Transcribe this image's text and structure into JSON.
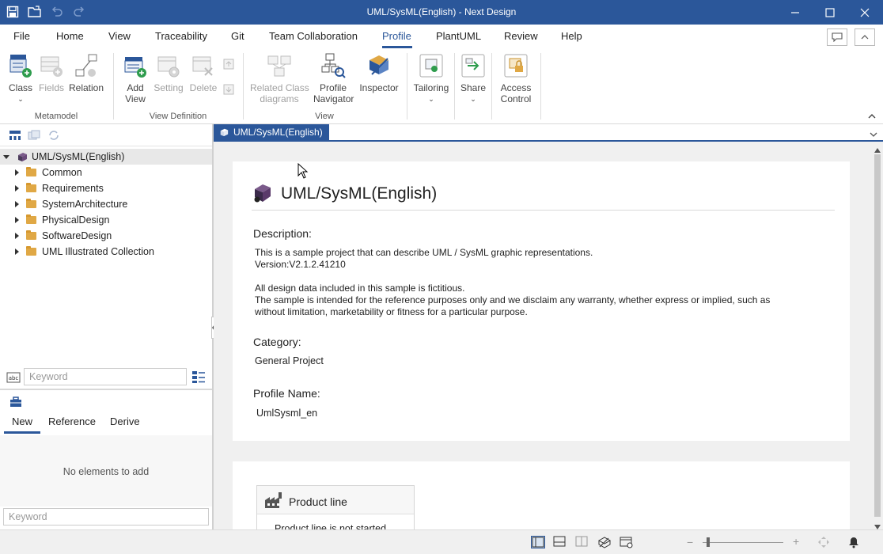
{
  "window": {
    "title": "UML/SysML(English) - Next Design"
  },
  "menu": {
    "items": [
      "File",
      "Home",
      "View",
      "Traceability",
      "Git",
      "Team Collaboration",
      "Profile",
      "PlantUML",
      "Review",
      "Help"
    ],
    "active": "Profile"
  },
  "ribbon": {
    "groups": {
      "metamodel": "Metamodel",
      "view_definition": "View Definition",
      "view": "View"
    },
    "buttons": {
      "class": "Class",
      "fields": "Fields",
      "relation": "Relation",
      "add_view_1": "Add",
      "add_view_2": "View",
      "setting": "Setting",
      "delete": "Delete",
      "related_1": "Related Class",
      "related_2": "diagrams",
      "profile_nav_1": "Profile",
      "profile_nav_2": "Navigator",
      "inspector": "Inspector",
      "tailoring": "Tailoring",
      "share": "Share",
      "access_1": "Access",
      "access_2": "Control"
    }
  },
  "tree": {
    "root": "UML/SysML(English)",
    "children": [
      "Common",
      "Requirements",
      "SystemArchitecture",
      "PhysicalDesign",
      "SoftwareDesign",
      "UML Illustrated Collection"
    ]
  },
  "search": {
    "tree_placeholder": "Keyword",
    "elements_placeholder": "Keyword"
  },
  "element_pane": {
    "tabs": [
      "New",
      "Reference",
      "Derive"
    ],
    "active_tab": "New",
    "empty_message": "No elements to add"
  },
  "document": {
    "tab_label": "UML/SysML(English)",
    "title": "UML/SysML(English)",
    "description_label": "Description:",
    "description_lines": [
      "This is a sample project that can describe UML / SysML graphic representations.",
      "Version:V2.1.2.41210",
      "All design data included in this sample is fictitious.",
      "The sample is intended for the reference purposes only and we disclaim any warranty, whether express or implied, such as",
      "without limitation, marketability or fitness for a particular purpose."
    ],
    "category_label": "Category:",
    "category_value": "General Project",
    "profile_label": "Profile Name:",
    "profile_value": "UmlSysml_en",
    "product_line_title": "Product line",
    "product_line_status": "Product line is not started"
  },
  "colors": {
    "accent": "#2b579a",
    "folder": "#e0a845"
  }
}
